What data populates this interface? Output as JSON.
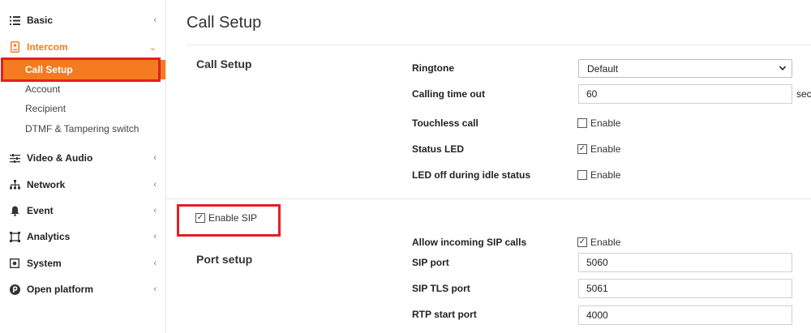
{
  "sidebar": {
    "items": [
      {
        "label": "Basic",
        "icon": "list-icon"
      },
      {
        "label": "Intercom",
        "icon": "intercom-icon"
      },
      {
        "label": "Video & Audio",
        "icon": "sliders-icon"
      },
      {
        "label": "Network",
        "icon": "network-icon"
      },
      {
        "label": "Event",
        "icon": "bell-icon"
      },
      {
        "label": "Analytics",
        "icon": "analytics-icon"
      },
      {
        "label": "System",
        "icon": "system-icon"
      },
      {
        "label": "Open platform",
        "icon": "open-platform-icon"
      }
    ],
    "sub_items": [
      {
        "label": "Call Setup"
      },
      {
        "label": "Account"
      },
      {
        "label": "Recipient"
      },
      {
        "label": "DTMF & Tampering switch"
      }
    ]
  },
  "main": {
    "page_title": "Call Setup",
    "call_setup": {
      "section_title": "Call Setup",
      "ringtone_label": "Ringtone",
      "ringtone_value": "Default",
      "timeout_label": "Calling time out",
      "timeout_value": "60",
      "timeout_unit": "sec",
      "touchless_label": "Touchless call",
      "touchless_enable": "Enable",
      "status_led_label": "Status LED",
      "status_led_enable": "Enable",
      "led_off_label": "LED off during idle status",
      "led_off_enable": "Enable"
    },
    "sip": {
      "enable_sip_label": "Enable SIP",
      "port_setup_title": "Port setup",
      "allow_incoming_label": "Allow incoming SIP calls",
      "allow_incoming_enable": "Enable",
      "sip_port_label": "SIP port",
      "sip_port_value": "5060",
      "sip_tls_port_label": "SIP TLS port",
      "sip_tls_port_value": "5061",
      "rtp_start_port_label": "RTP start port",
      "rtp_start_port_value": "4000"
    },
    "checkmark": "✓"
  },
  "colors": {
    "accent": "#f47b20",
    "highlight": "#e31e24"
  }
}
